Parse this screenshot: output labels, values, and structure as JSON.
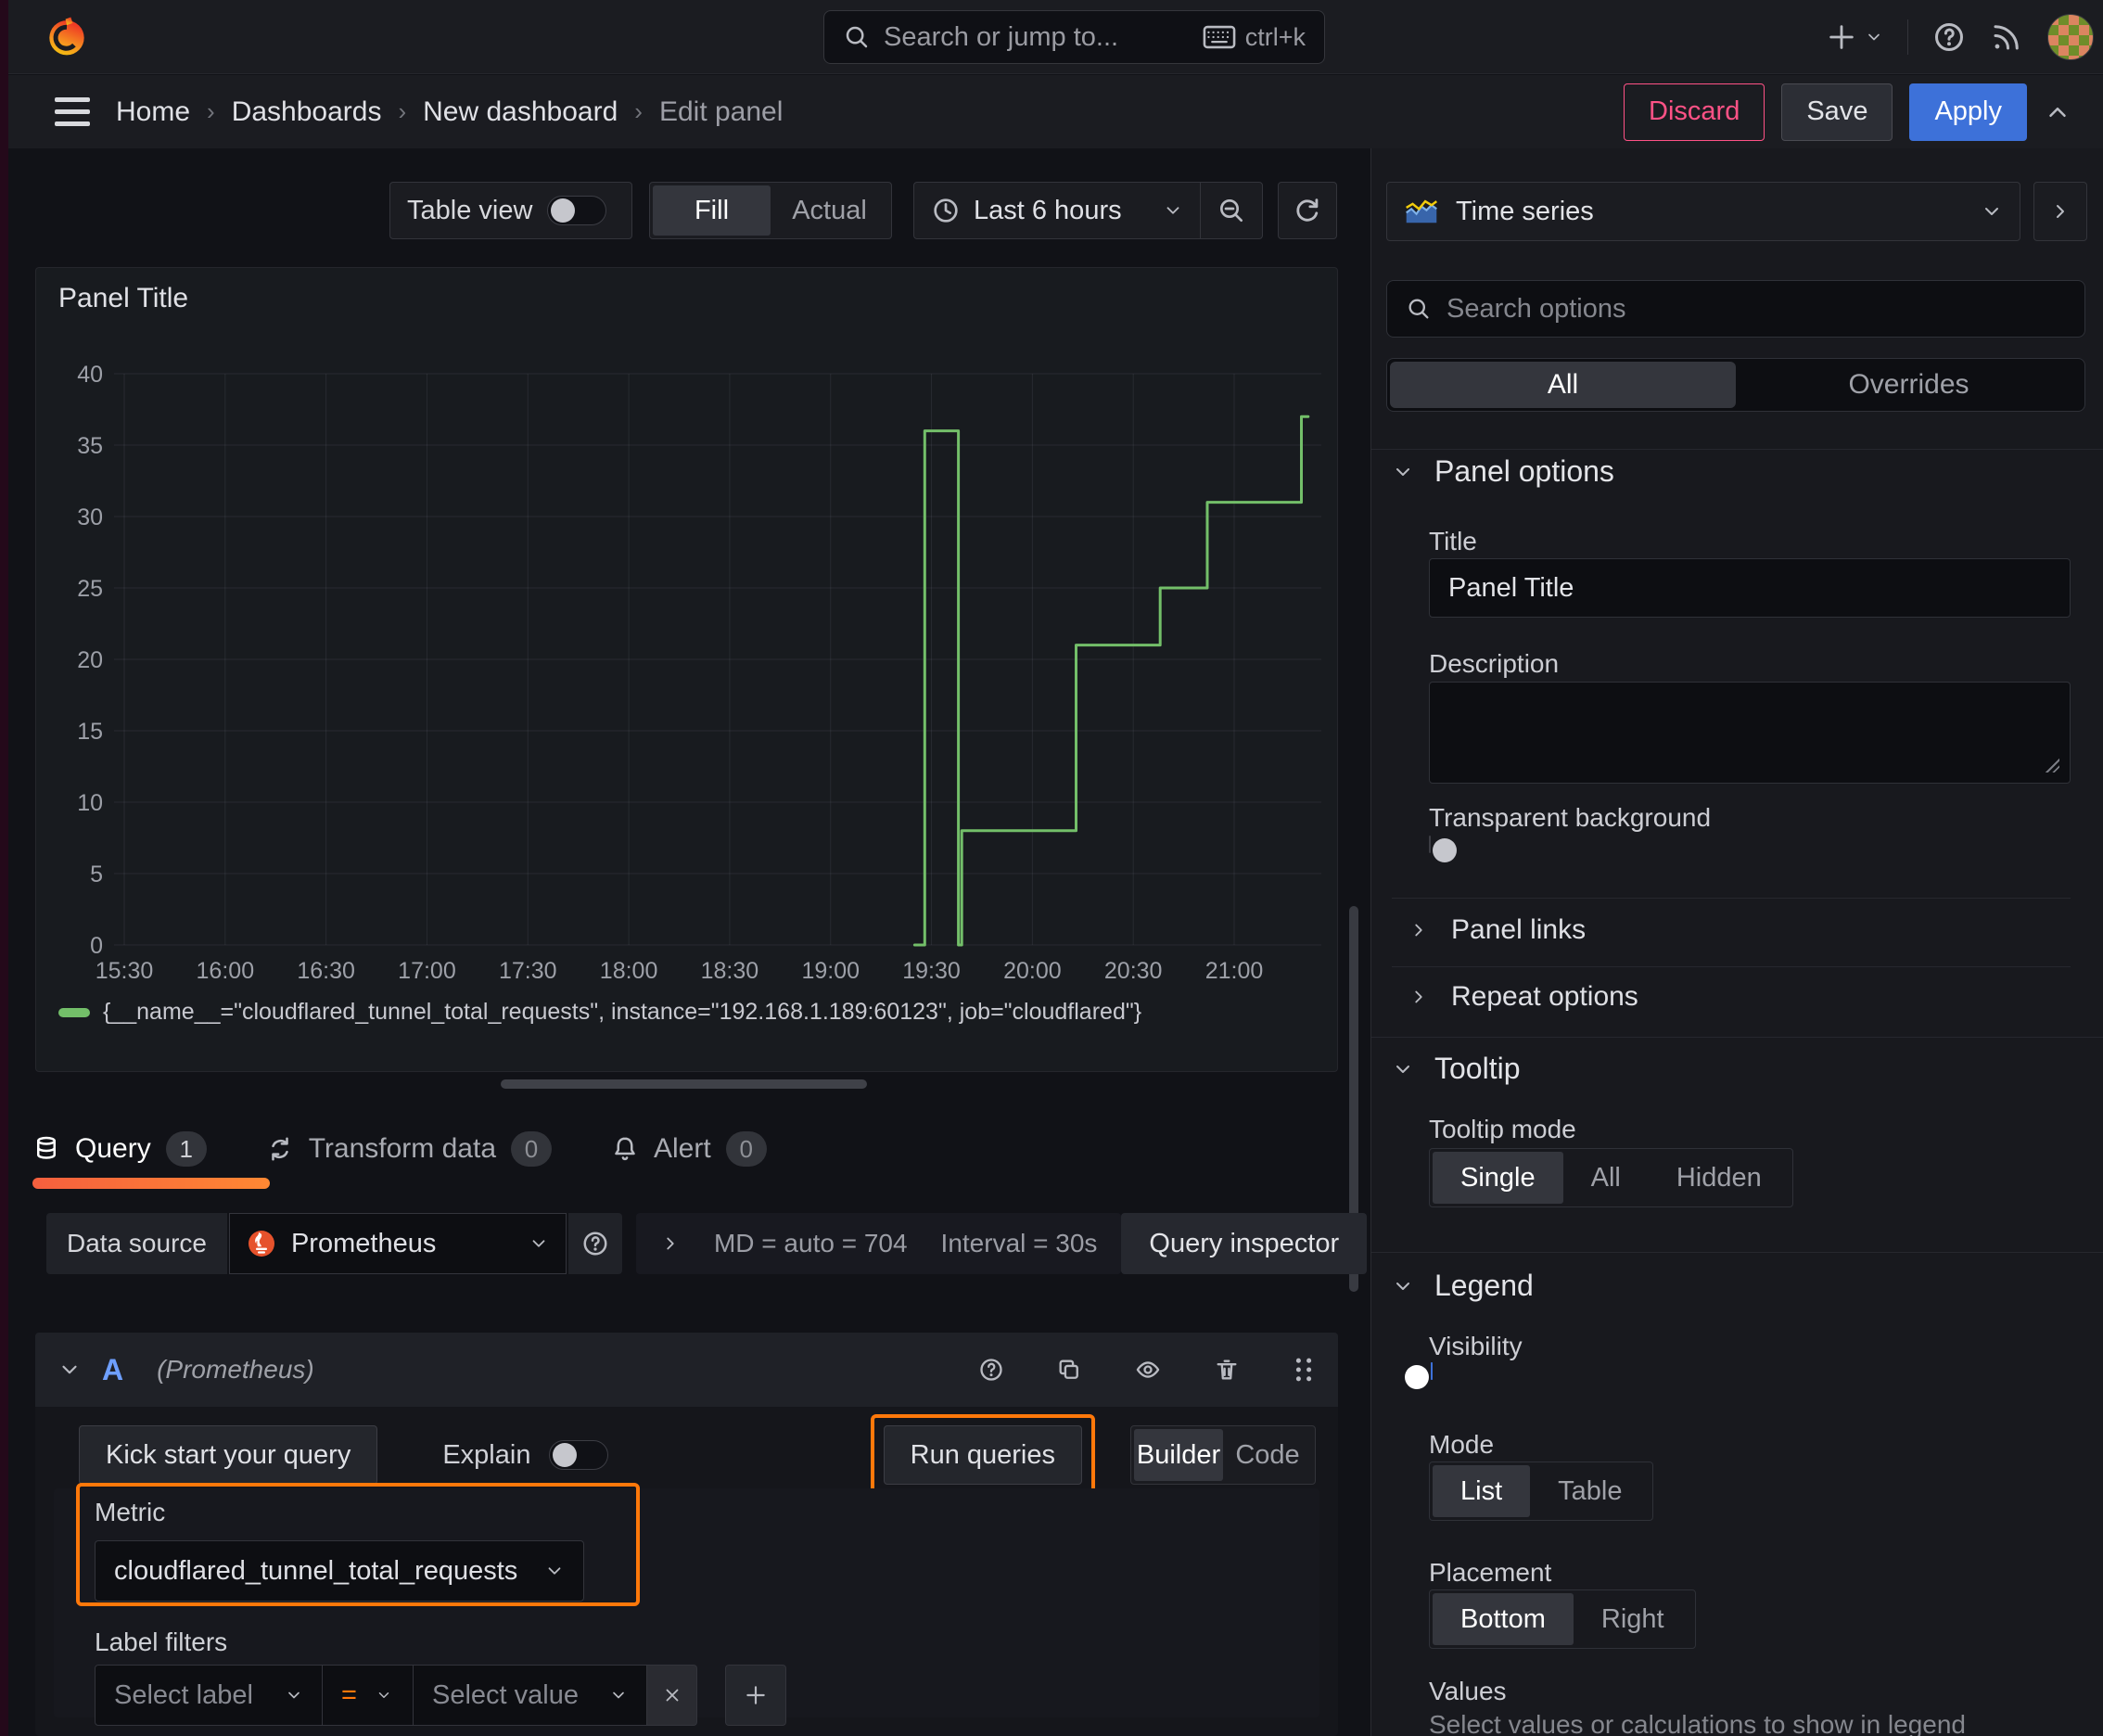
{
  "topbar": {
    "search_placeholder": "Search or jump to...",
    "search_shortcut": "ctrl+k"
  },
  "breadcrumb": {
    "items": [
      "Home",
      "Dashboards",
      "New dashboard",
      "Edit panel"
    ],
    "discard_label": "Discard",
    "save_label": "Save",
    "apply_label": "Apply"
  },
  "toolbar": {
    "table_view_label": "Table view",
    "fill_label": "Fill",
    "actual_label": "Actual",
    "time_range_label": "Last 6 hours"
  },
  "panel": {
    "title": "Panel Title"
  },
  "chart_data": {
    "type": "line",
    "mode": "step-after",
    "title": "Panel Title",
    "x_ticks": [
      "15:30",
      "16:00",
      "16:30",
      "17:00",
      "17:30",
      "18:00",
      "18:30",
      "19:00",
      "19:30",
      "20:00",
      "20:30",
      "21:00"
    ],
    "y_ticks": [
      0,
      5,
      10,
      15,
      20,
      25,
      30,
      35,
      40
    ],
    "ylim": [
      0,
      40
    ],
    "grid": true,
    "legend_position": "bottom",
    "series": [
      {
        "name": "{__name__=\"cloudflared_tunnel_total_requests\", instance=\"192.168.1.189:60123\", job=\"cloudflared\"}",
        "color": "#73bf69",
        "points": [
          {
            "time": "19:25",
            "value": 0
          },
          {
            "time": "19:28",
            "value": 36
          },
          {
            "time": "19:38",
            "value": 0
          },
          {
            "time": "19:39",
            "value": 8
          },
          {
            "time": "20:13",
            "value": 21
          },
          {
            "time": "20:38",
            "value": 25
          },
          {
            "time": "20:52",
            "value": 31
          },
          {
            "time": "21:20",
            "value": 37
          }
        ],
        "end_time": "21:22"
      }
    ]
  },
  "tabs": {
    "query_label": "Query",
    "query_count": "1",
    "transform_label": "Transform data",
    "transform_count": "0",
    "alert_label": "Alert",
    "alert_count": "0"
  },
  "datasource": {
    "label": "Data source",
    "name": "Prometheus",
    "stat_md": "MD = auto = 704",
    "stat_interval": "Interval = 30s",
    "query_inspector_label": "Query inspector"
  },
  "query_editor": {
    "ref_id": "A",
    "ds_hint": "(Prometheus)",
    "kick_start_label": "Kick start your query",
    "explain_label": "Explain",
    "run_queries_label": "Run queries",
    "builder_label": "Builder",
    "code_label": "Code",
    "metric_label": "Metric",
    "metric_value": "cloudflared_tunnel_total_requests",
    "label_filters_label": "Label filters",
    "select_label_placeholder": "Select label",
    "operator": "=",
    "select_value_placeholder": "Select value",
    "remove_glyph": "x"
  },
  "options": {
    "viz_type": "Time series",
    "search_placeholder": "Search options",
    "tab_all": "All",
    "tab_overrides": "Overrides",
    "panel_options": {
      "heading": "Panel options",
      "title_label": "Title",
      "title_value": "Panel Title",
      "description_label": "Description",
      "transparent_label": "Transparent background"
    },
    "panel_links_label": "Panel links",
    "repeat_options_label": "Repeat options",
    "tooltip": {
      "heading": "Tooltip",
      "mode_label": "Tooltip mode",
      "single": "Single",
      "all": "All",
      "hidden": "Hidden"
    },
    "legend": {
      "heading": "Legend",
      "visibility_label": "Visibility",
      "mode_label": "Mode",
      "list": "List",
      "table": "Table",
      "placement_label": "Placement",
      "bottom": "Bottom",
      "right": "Right",
      "values_label": "Values",
      "values_help": "Select values or calculations to show in legend"
    }
  },
  "colors": {
    "accent_orange": "#ff780a",
    "series_green": "#73bf69",
    "primary_blue": "#3d71d9",
    "destructive_pink": "#ff5286",
    "ref_id_blue": "#6e9fff"
  }
}
